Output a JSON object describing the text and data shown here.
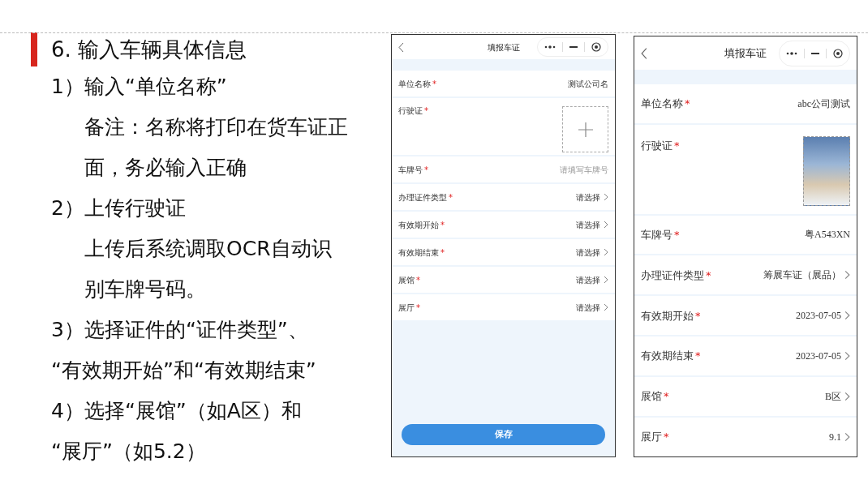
{
  "slide": {
    "title": "6. 输入车辆具体信息",
    "lines": [
      {
        "kind": "step",
        "text": "1）输入“单位名称”"
      },
      {
        "kind": "note",
        "text": "备注：名称将打印在货车证正"
      },
      {
        "kind": "note",
        "text": "面，务必输入正确"
      },
      {
        "kind": "step",
        "text": "2）上传行驶证"
      },
      {
        "kind": "note",
        "text": "上传后系统调取OCR自动识"
      },
      {
        "kind": "note",
        "text": "别车牌号码。"
      },
      {
        "kind": "step",
        "text": "3）选择证件的“证件类型”、"
      },
      {
        "kind": "step",
        "text": "“有效期开始”和“有效期结束”"
      },
      {
        "kind": "step",
        "text": "4）选择“展馆”（如A区）和"
      },
      {
        "kind": "step",
        "text": "“展厅”（如5.2）"
      }
    ]
  },
  "phones": [
    {
      "title": "填报车证",
      "save_button": "保存",
      "fields": [
        {
          "kind": "text",
          "label": "单位名称",
          "required_mark": "*",
          "value": "测试公司名"
        },
        {
          "kind": "upload",
          "label": "行驶证",
          "required_mark": "*",
          "has_image": false
        },
        {
          "kind": "placeholder",
          "label": "车牌号",
          "required_mark": "*",
          "placeholder": "请填写车牌号"
        },
        {
          "kind": "select",
          "label": "办理证件类型",
          "required_mark": "*",
          "value": "请选择"
        },
        {
          "kind": "select",
          "label": "有效期开始",
          "required_mark": "*",
          "value": "请选择"
        },
        {
          "kind": "select",
          "label": "有效期结束",
          "required_mark": "*",
          "value": "请选择"
        },
        {
          "kind": "select",
          "label": "展馆",
          "required_mark": "*",
          "value": "请选择"
        },
        {
          "kind": "select",
          "label": "展厅",
          "required_mark": "*",
          "value": "请选择"
        }
      ]
    },
    {
      "title": "填报车证",
      "fields": [
        {
          "kind": "text",
          "label": "单位名称",
          "required_mark": "*",
          "value": "abc公司测试"
        },
        {
          "kind": "upload",
          "label": "行驶证",
          "required_mark": "*",
          "has_image": true
        },
        {
          "kind": "text",
          "label": "车牌号",
          "required_mark": "*",
          "value": "粤A543XN"
        },
        {
          "kind": "select",
          "label": "办理证件类型",
          "required_mark": "*",
          "value": "筹展车证（展品）"
        },
        {
          "kind": "select",
          "label": "有效期开始",
          "required_mark": "*",
          "value": "2023-07-05"
        },
        {
          "kind": "select",
          "label": "有效期结束",
          "required_mark": "*",
          "value": "2023-07-05"
        },
        {
          "kind": "select",
          "label": "展馆",
          "required_mark": "*",
          "value": "B区"
        },
        {
          "kind": "select",
          "label": "展厅",
          "required_mark": "*",
          "value": "9.1"
        }
      ]
    }
  ]
}
